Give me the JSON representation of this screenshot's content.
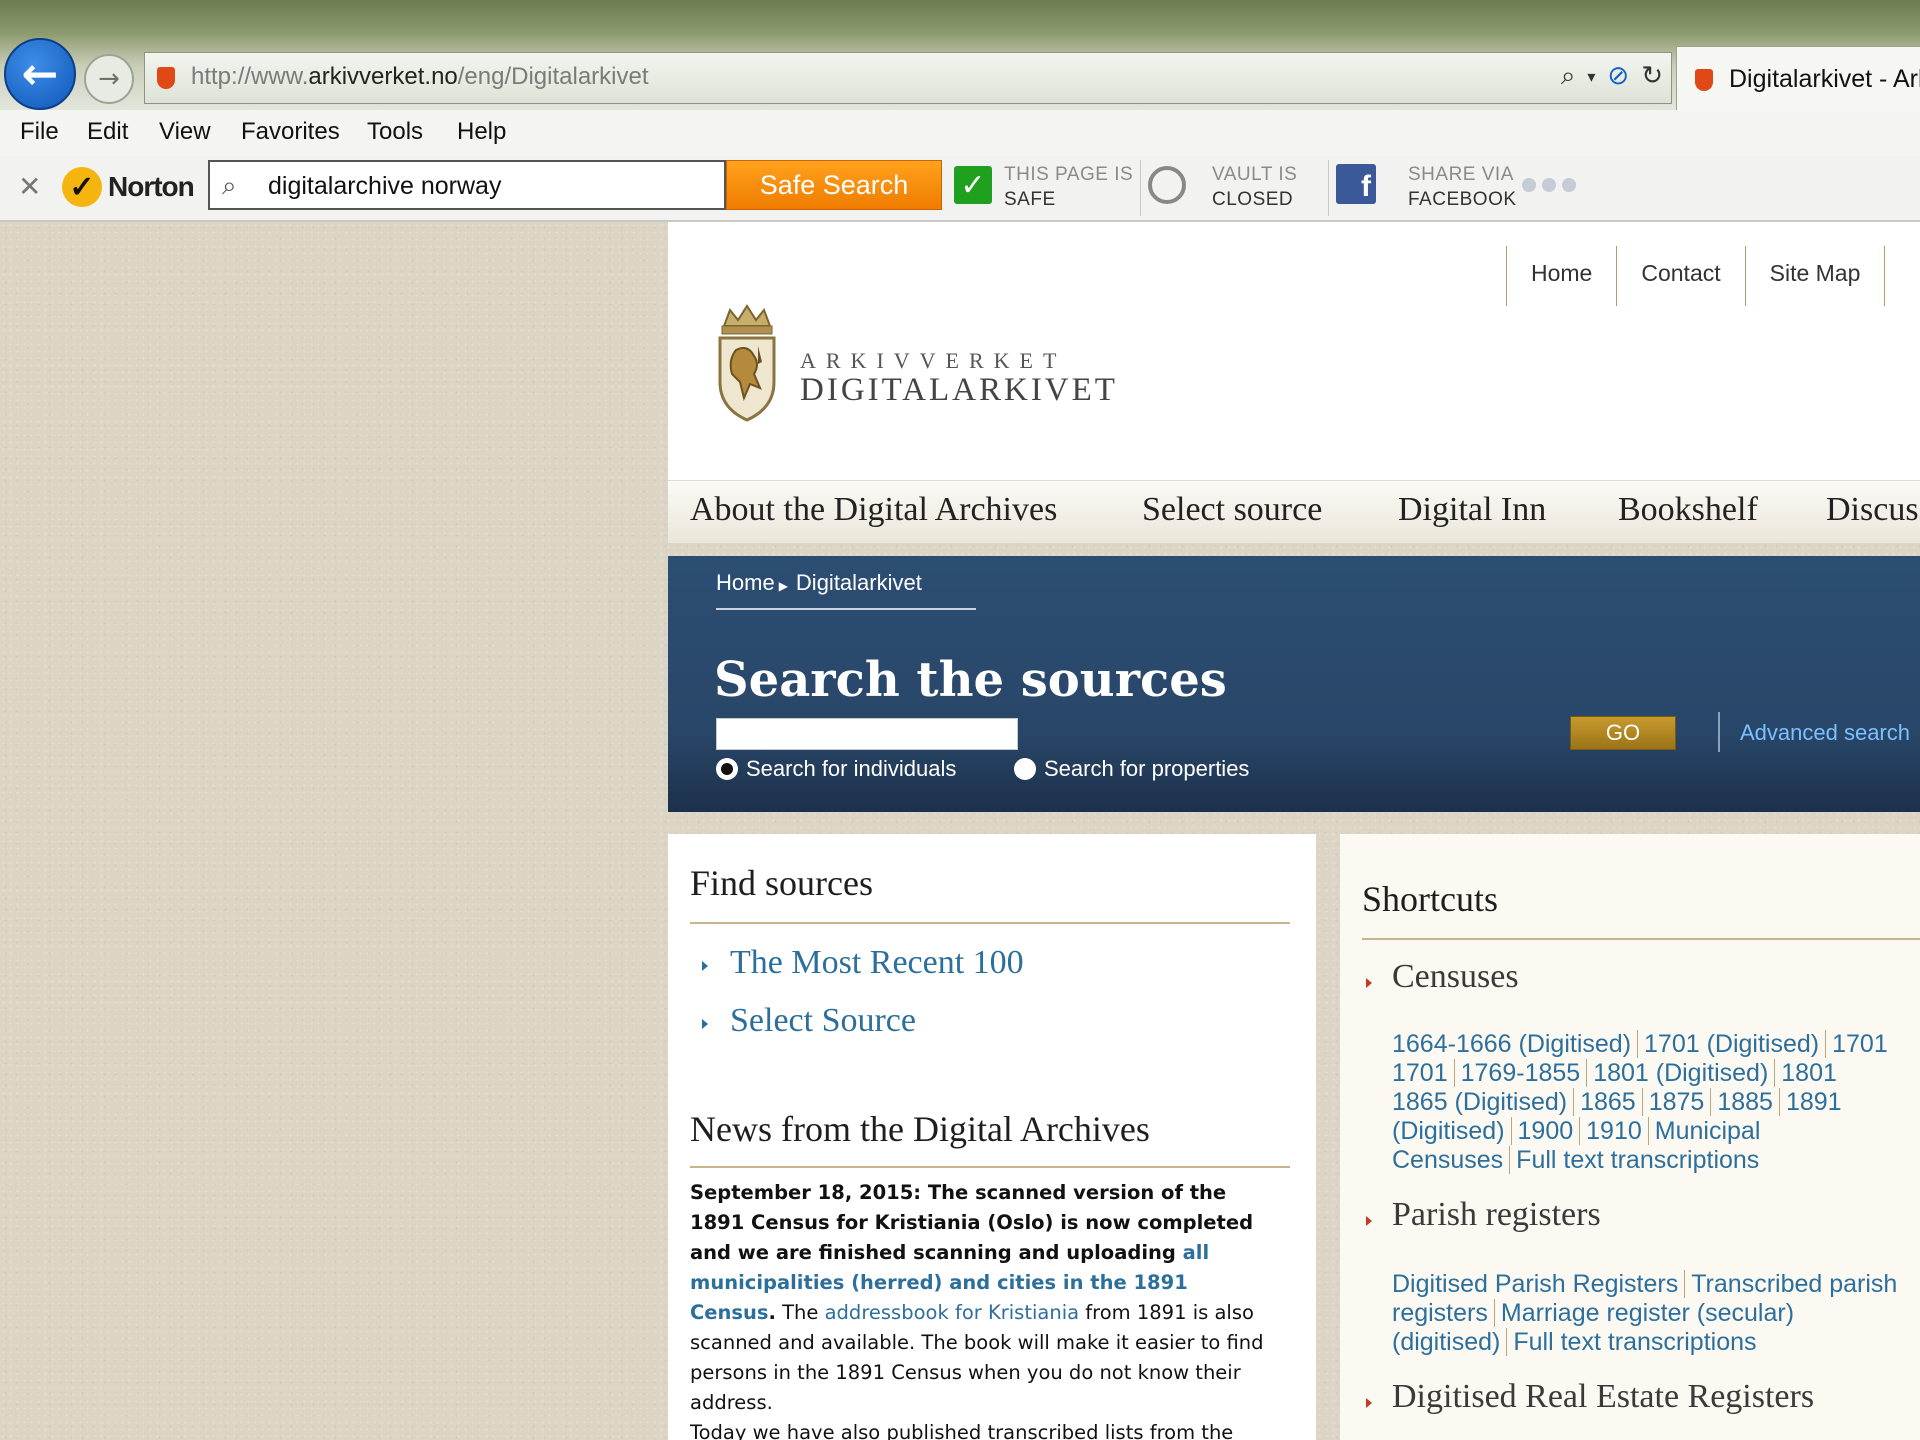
{
  "browser": {
    "url_prefix": "http://www.",
    "url_domain": "arkivverket.no",
    "url_path": "/eng/Digitalarkivet",
    "tab_title": "Digitalarkivet - Arkivverket",
    "menu": [
      "File",
      "Edit",
      "View",
      "Favorites",
      "Tools",
      "Help"
    ]
  },
  "norton": {
    "brand": "Norton",
    "search_value": "digitalarchive norway",
    "safe_search_label": "Safe Search",
    "page_status_line1": "THIS PAGE IS",
    "page_status_line2": "SAFE",
    "vault_line1": "VAULT IS",
    "vault_line2": "CLOSED",
    "share_line1": "SHARE VIA",
    "share_line2": "FACEBOOK"
  },
  "site": {
    "toplinks": [
      "Home",
      "Contact",
      "Site Map"
    ],
    "logo_line1": "ARKIVVERKET",
    "logo_line2": "DIGITALARKIVET",
    "nav": [
      "About the Digital Archives",
      "Select source",
      "Digital Inn",
      "Bookshelf",
      "Discussion"
    ],
    "breadcrumb": [
      "Home",
      "Digitalarkivet"
    ],
    "search_title": "Search the sources",
    "radio_individuals": "Search for individuals",
    "radio_properties": "Search for properties",
    "go_label": "GO",
    "advanced_label": "Advanced search"
  },
  "find_sources": {
    "title": "Find sources",
    "links": [
      "The Most Recent 100",
      "Select Source"
    ]
  },
  "news": {
    "title": "News from the Digital Archives",
    "bold_intro": "September 18, 2015: The scanned version of the 1891 Census for Kristiania (Oslo) is now completed and we are finished scanning and uploading ",
    "bold_link": "all municipalities (herred) and cities in the 1891 Census",
    "bold_end": ".",
    "text1": " The ",
    "link2": "addressbook for Kristiania",
    "text2": " from 1891 is also scanned and available. The book will make it easier to find persons in the 1891 Census when you do not know their address.",
    "text3": "Today we have also published transcribed lists from the"
  },
  "shortcuts": {
    "title": "Shortcuts",
    "censuses": {
      "label": "Censuses",
      "links": [
        "1664-1666 (Digitised)",
        "1701 (Digitised)",
        "1701",
        "1769-1855",
        "1801 (Digitised)",
        "1801",
        "1865 (Digitised)",
        "1865",
        "1875",
        "1885",
        "1891",
        "1891 (Digitised)",
        "1900",
        "1910",
        "Municipal Censuses",
        "Full text transcriptions"
      ]
    },
    "parish": {
      "label": "Parish registers",
      "links": [
        "Digitised Parish Registers",
        "Transcribed parish registers",
        "Marriage register (secular) (digitised)",
        "Full text transcriptions"
      ]
    },
    "real_estate": {
      "label": "Digitised Real Estate Registers"
    }
  }
}
